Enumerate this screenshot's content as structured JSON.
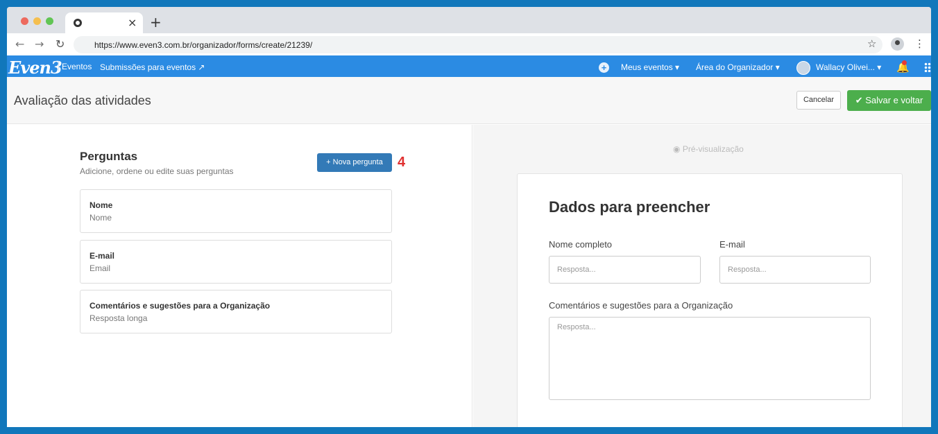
{
  "browser": {
    "url": "https://www.even3.com.br/organizador/forms/create/21239/",
    "tab_close": "×",
    "new_tab": "+"
  },
  "navbar": {
    "logo": "Even3",
    "eventos": "Eventos",
    "submissoes": "Submissões para eventos ↗",
    "meus_eventos": "Meus eventos ▾",
    "area_organizador": "Área do Organizador ▾",
    "user": "Wallacy Olivei... ▾"
  },
  "page": {
    "title": "Avaliação das atividades",
    "cancel": "Cancelar",
    "save": "✔ Salvar e voltar"
  },
  "questions": {
    "title": "Perguntas",
    "subtitle": "Adicione, ordene ou edite suas perguntas",
    "new_button": "+ Nova pergunta",
    "step_marker": "4",
    "items": [
      {
        "label": "Nome",
        "type": "Nome"
      },
      {
        "label": "E-mail",
        "type": "Email"
      },
      {
        "label": "Comentários e sugestões para a Organização",
        "type": "Resposta longa"
      }
    ]
  },
  "preview": {
    "label": "Pré-visualização",
    "form_title": "Dados para preencher",
    "fields": [
      {
        "label": "Nome completo",
        "placeholder": "Resposta..."
      },
      {
        "label": "E-mail",
        "placeholder": "Resposta..."
      },
      {
        "label": "Comentários e sugestões para a Organização",
        "placeholder": "Resposta..."
      }
    ]
  },
  "colors": {
    "navbar": "#2b8be3",
    "save_button": "#4cae4c",
    "new_question_button": "#337ab7",
    "step_marker": "#e03030"
  }
}
